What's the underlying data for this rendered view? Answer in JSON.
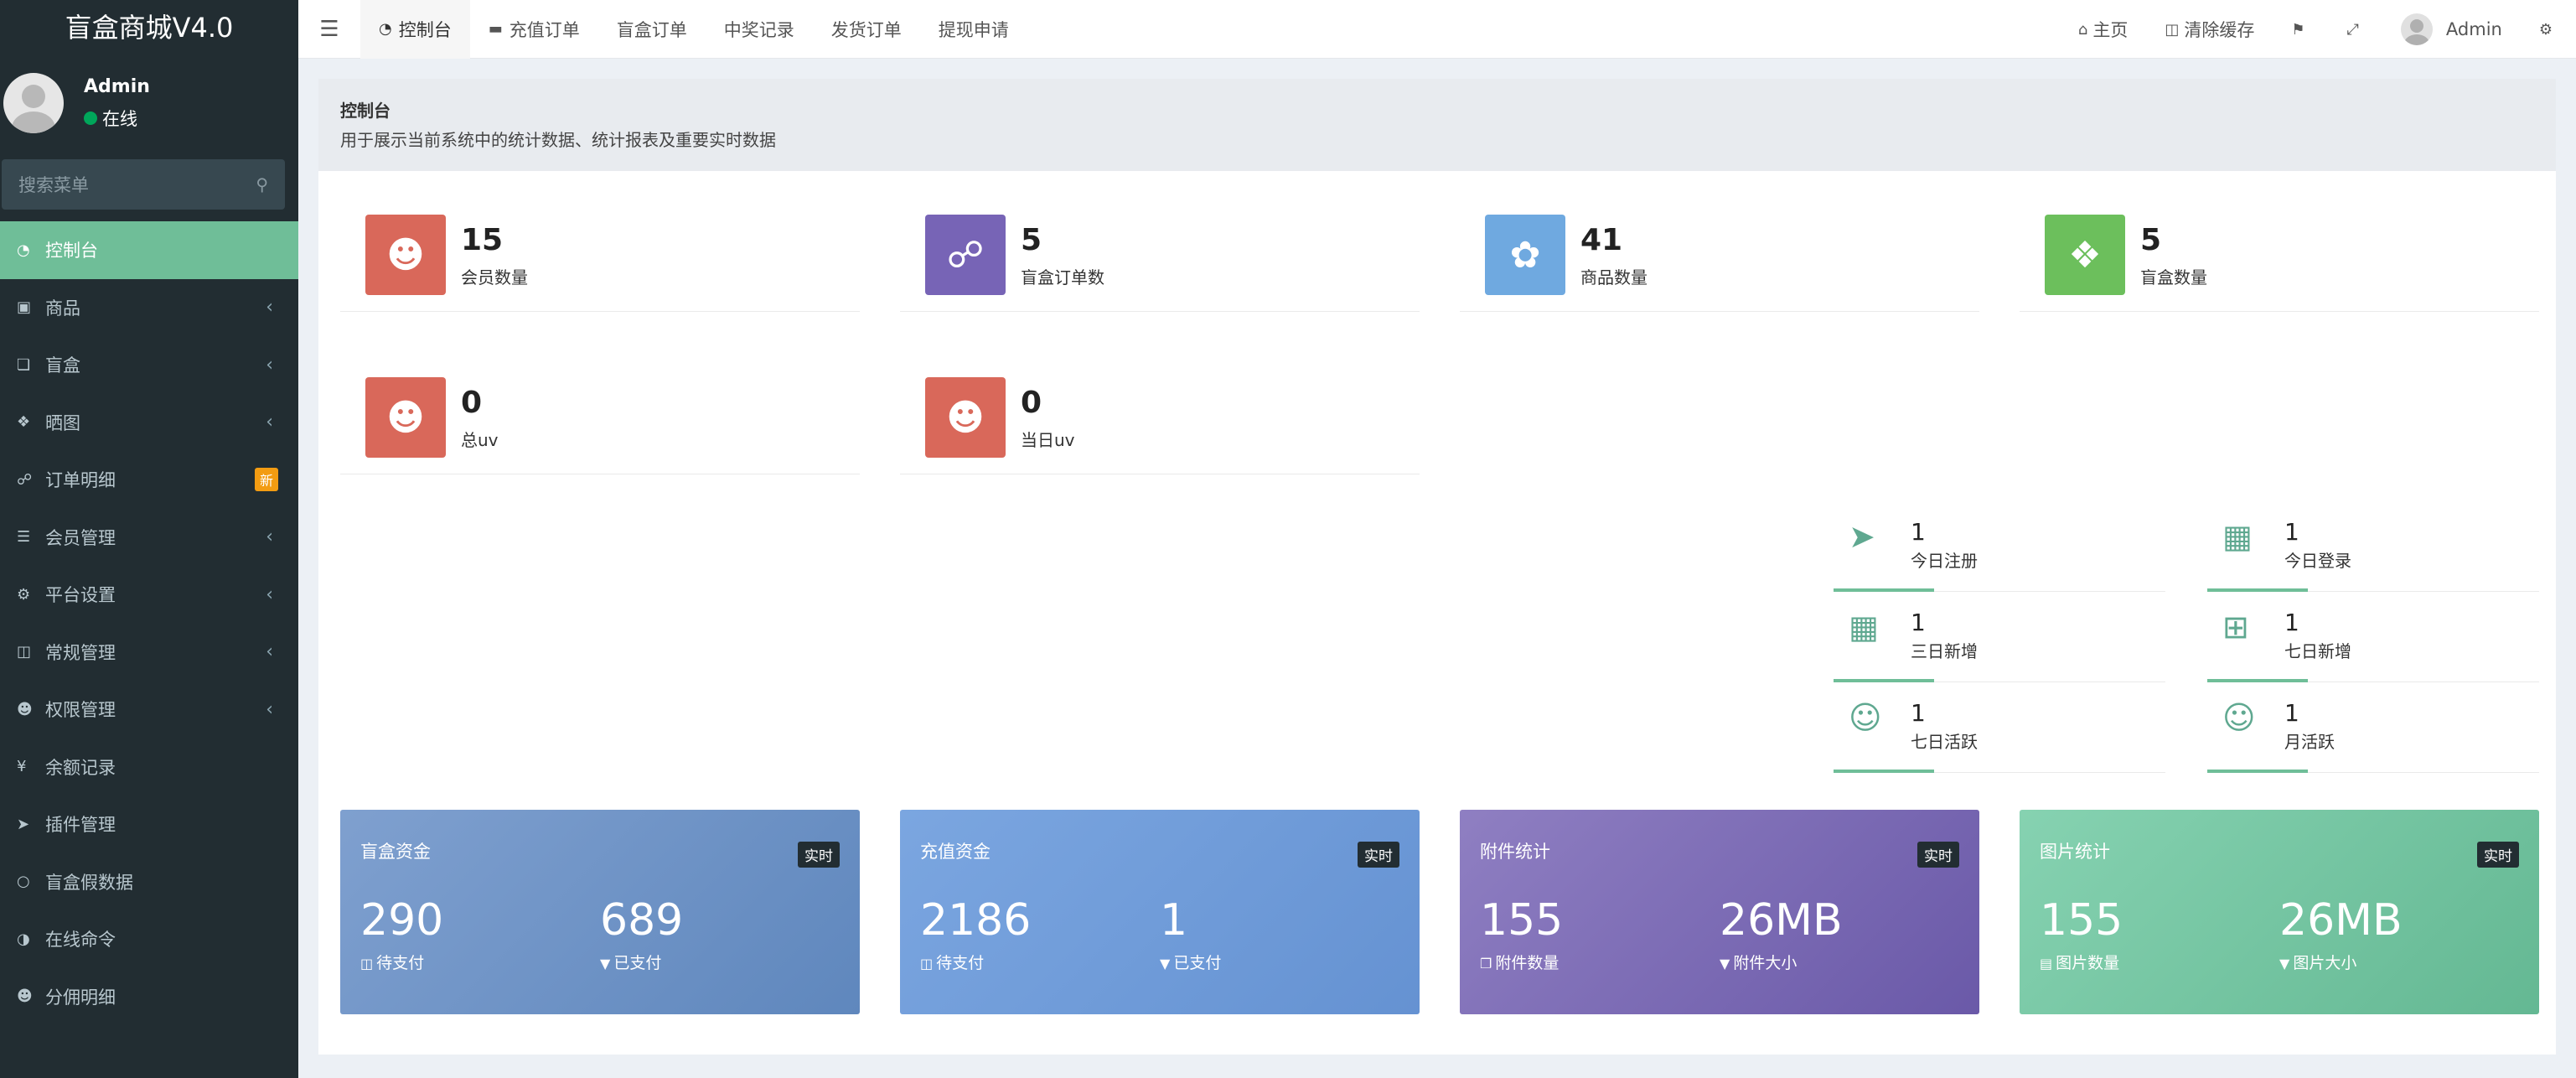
{
  "sidebar": {
    "logo": "盲盒商城V4.0",
    "user": {
      "name": "Admin",
      "status": "在线"
    },
    "search_placeholder": "搜索菜单",
    "items": [
      {
        "label": "控制台",
        "icon": "dashboard-icon"
      },
      {
        "label": "商品",
        "icon": "shopping-bag-icon"
      },
      {
        "label": "盲盒",
        "icon": "cube-icon"
      },
      {
        "label": "晒图",
        "icon": "dropbox-icon"
      },
      {
        "label": "订单明细",
        "icon": "cart-icon",
        "badge": "新"
      },
      {
        "label": "会员管理",
        "icon": "list-icon"
      },
      {
        "label": "平台设置",
        "icon": "gear-icon"
      },
      {
        "label": "常规管理",
        "icon": "database-icon"
      },
      {
        "label": "权限管理",
        "icon": "users-icon"
      },
      {
        "label": "余额记录",
        "icon": "yen-icon"
      },
      {
        "label": "插件管理",
        "icon": "rocket-icon"
      },
      {
        "label": "盲盒假数据",
        "icon": "circle-icon"
      },
      {
        "label": "在线命令",
        "icon": "contrast-icon"
      },
      {
        "label": "分佣明细",
        "icon": "users-icon"
      }
    ]
  },
  "topbar": {
    "tabs": [
      "控制台",
      "充值订单",
      "盲盒订单",
      "中奖记录",
      "发货订单",
      "提现申请"
    ],
    "home": "主页",
    "clear_cache": "清除缓存",
    "admin": "Admin"
  },
  "header": {
    "title": "控制台",
    "desc": "用于展示当前系统中的统计数据、统计报表及重要实时数据"
  },
  "stats": [
    {
      "value": "15",
      "label": "会员数量",
      "color": "#d9685a",
      "icon": "users-icon"
    },
    {
      "value": "5",
      "label": "盲盒订单数",
      "color": "#7764b6",
      "icon": "cart-icon"
    },
    {
      "value": "41",
      "label": "商品数量",
      "color": "#6fa9e0",
      "icon": "leaf-icon"
    },
    {
      "value": "5",
      "label": "盲盒数量",
      "color": "#6cbf5c",
      "icon": "dropbox-icon"
    },
    {
      "value": "0",
      "label": "总uv",
      "color": "#d9685a",
      "icon": "users-icon"
    },
    {
      "value": "0",
      "label": "当日uv",
      "color": "#d9685a",
      "icon": "users-icon"
    }
  ],
  "mini_stats": [
    {
      "value": "1",
      "label": "今日注册",
      "icon": "rocket-icon"
    },
    {
      "value": "1",
      "label": "今日登录",
      "icon": "id-card-icon"
    },
    {
      "value": "1",
      "label": "三日新增",
      "icon": "calendar-icon"
    },
    {
      "value": "1",
      "label": "七日新增",
      "icon": "calendar-plus-icon"
    },
    {
      "value": "1",
      "label": "七日活跃",
      "icon": "user-circle-icon"
    },
    {
      "value": "1",
      "label": "月活跃",
      "icon": "user-circle-icon"
    }
  ],
  "cards": [
    {
      "title": "盲盒资金",
      "tag": "实时",
      "v1": "290",
      "l1": "待支付",
      "v2": "689",
      "l2": "已支付",
      "color": "#6e93c4"
    },
    {
      "title": "充值资金",
      "tag": "实时",
      "v1": "2186",
      "l1": "待支付",
      "v2": "1",
      "l2": "已支付",
      "color": "#6f9bd8"
    },
    {
      "title": "附件统计",
      "tag": "实时",
      "v1": "155",
      "l1": "附件数量",
      "v2": "26MB",
      "l2": "附件大小",
      "color": "#7a6bb3"
    },
    {
      "title": "图片统计",
      "tag": "实时",
      "v1": "155",
      "l1": "图片数量",
      "v2": "26MB",
      "l2": "图片大小",
      "color": "#73c4a2"
    }
  ]
}
